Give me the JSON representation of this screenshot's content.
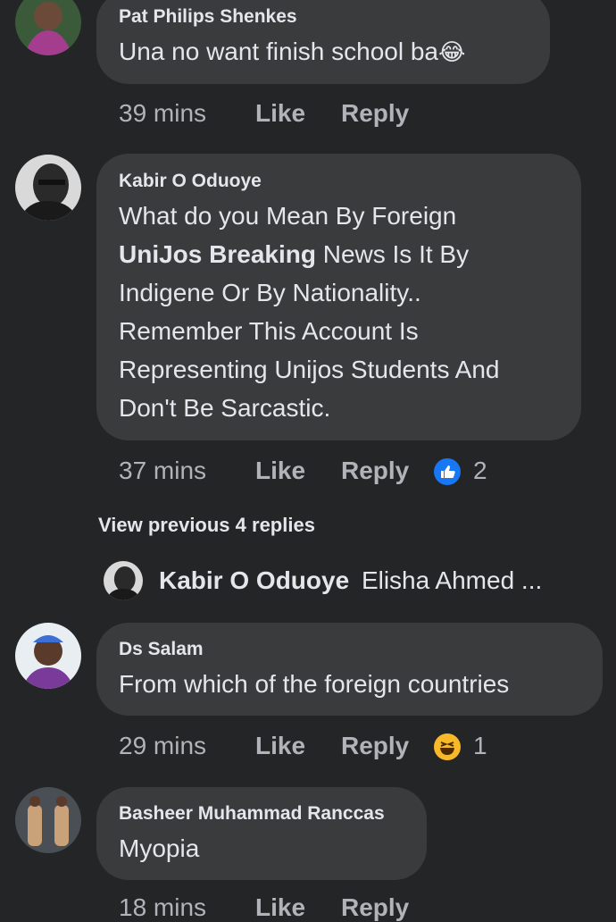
{
  "comments": [
    {
      "author": "Pat Philips Shenkes",
      "text": "Una no want finish school ba",
      "emoji": "😂",
      "time": "39 mins",
      "like": "Like",
      "reply": "Reply"
    },
    {
      "author": "Kabir O Oduoye",
      "text_lines": [
        "What do you Mean By Foreign",
        "UniJos Breaking",
        " News Is It By",
        "Indigene Or By Nationality..",
        "Remember This Account Is",
        "Representing Unijos Students And",
        "Don't Be Sarcastic."
      ],
      "time": "37 mins",
      "like": "Like",
      "reply": "Reply",
      "reaction": "like-icon",
      "reaction_count": "2"
    }
  ],
  "view_previous": "View previous 4 replies",
  "reply_preview": {
    "author": "Kabir O Oduoye",
    "text": "Elisha Ahmed ..."
  },
  "comments2": [
    {
      "author": "Ds Salam",
      "text": "From which of the foreign countries",
      "time": "29 mins",
      "like": "Like",
      "reply": "Reply",
      "reaction": "haha-icon",
      "reaction_count": "1"
    },
    {
      "author": "Basheer Muhammad Ranccas",
      "text": "Myopia",
      "time": "18 mins",
      "like": "Like",
      "reply": "Reply"
    }
  ],
  "colors": {
    "background": "#242526",
    "bubble": "#3a3b3c",
    "text": "#e4e6eb",
    "secondary": "#b0b3b8",
    "like_blue": "#1877f2",
    "haha_yellow": "#f7b928"
  }
}
